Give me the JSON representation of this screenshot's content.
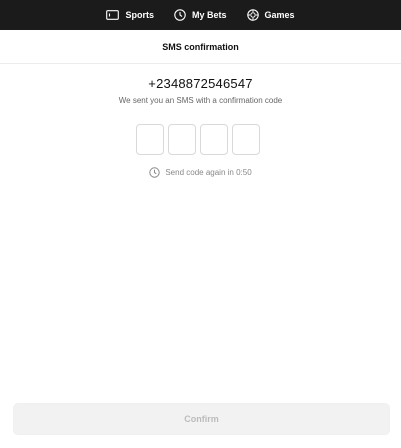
{
  "nav": {
    "items": [
      {
        "label": "Sports",
        "icon": "ticket-icon"
      },
      {
        "label": "My Bets",
        "icon": "clock-icon"
      },
      {
        "label": "Games",
        "icon": "chip-icon"
      }
    ]
  },
  "header": {
    "title": "SMS confirmation"
  },
  "verification": {
    "phone": "+2348872546547",
    "message": "We sent you an SMS with a confirmation code",
    "code_digits": [
      "",
      "",
      "",
      ""
    ],
    "resend_text": "Send code again in 0:50"
  },
  "footer": {
    "confirm_label": "Confirm"
  },
  "colors": {
    "topbar_bg": "#1b1b1b",
    "button_disabled_bg": "#f2f2f2",
    "button_disabled_text": "#bcbcbc"
  }
}
